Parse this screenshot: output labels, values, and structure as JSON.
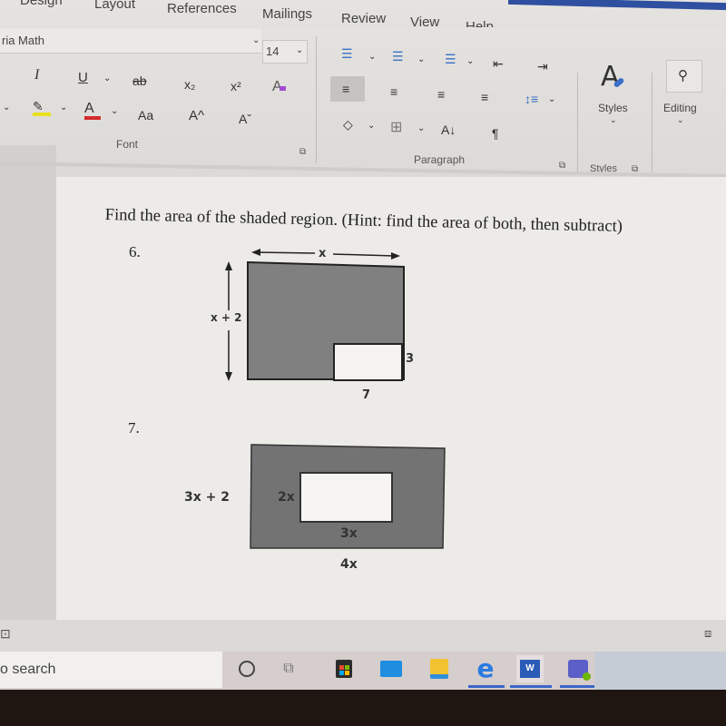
{
  "ribbon_tabs": [
    "Design",
    "Layout",
    "References",
    "Mailings",
    "Review",
    "View",
    "Help"
  ],
  "font_group": {
    "font_name": "ria Math",
    "font_size": "14",
    "label": "Font",
    "buttons": {
      "italic": "I",
      "underline": "U",
      "strikethrough": "ab",
      "subscript": "x₂",
      "superscript": "x²",
      "clear_formatting": "A",
      "highlight_color": "#e8e020",
      "font_color": "#d42a2a",
      "font_color_letter": "A",
      "change_case": "Aa",
      "grow_font": "A^",
      "shrink_font": "Aˇ"
    }
  },
  "paragraph_group": {
    "label": "Paragraph",
    "sort_glyph": "A↓",
    "pilcrow": "¶"
  },
  "styles_group": {
    "button_label": "Styles",
    "label": "Styles"
  },
  "editing_group": {
    "button_label": "Editing"
  },
  "document": {
    "instruction": "Find the area of the shaded region. (Hint: find the area of both, then subtract)",
    "problems": [
      {
        "number": "6.",
        "labels": {
          "top": "x",
          "left": "x + 2",
          "inner_right": "3",
          "inner_bottom": "7"
        }
      },
      {
        "number": "7.",
        "labels": {
          "outer_left": "3x + 2",
          "inner_left": "2x",
          "inner_bottom": "3x",
          "outer_bottom": "4x"
        }
      }
    ],
    "shade_color": "#808080"
  },
  "taskbar": {
    "search_placeholder": "o search",
    "apps": [
      "cortana",
      "task-view",
      "microsoft-store",
      "mail",
      "file-explorer",
      "edge",
      "word",
      "teams"
    ]
  }
}
